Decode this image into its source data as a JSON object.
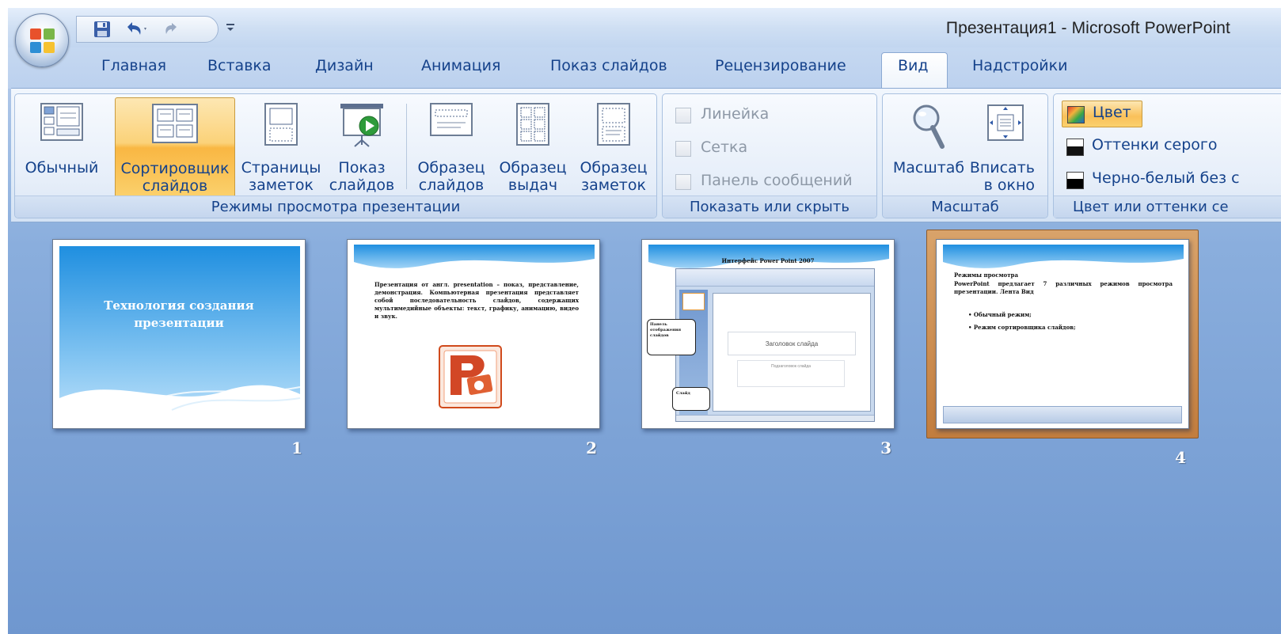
{
  "window": {
    "title": "Презентация1 - Microsoft PowerPoint"
  },
  "tabs": [
    {
      "label": "Главная"
    },
    {
      "label": "Вставка"
    },
    {
      "label": "Дизайн"
    },
    {
      "label": "Анимация"
    },
    {
      "label": "Показ слайдов"
    },
    {
      "label": "Рецензирование"
    },
    {
      "label": "Вид",
      "active": true
    },
    {
      "label": "Надстройки"
    }
  ],
  "ribbon": {
    "views": {
      "label": "Режимы просмотра презентации",
      "buttons": [
        {
          "label": "Обычный",
          "icon": "normal-view-icon"
        },
        {
          "label": "Сортировщик\nслайдов",
          "icon": "slide-sorter-icon",
          "active": true
        },
        {
          "label": "Страницы\nзаметок",
          "icon": "notes-page-icon"
        },
        {
          "label": "Показ\nслайдов",
          "icon": "slide-show-icon"
        },
        {
          "label": "Образец\nслайдов",
          "icon": "slide-master-icon"
        },
        {
          "label": "Образец\nвыдач",
          "icon": "handout-master-icon"
        },
        {
          "label": "Образец\nзаметок",
          "icon": "notes-master-icon"
        }
      ]
    },
    "show_hide": {
      "label": "Показать или скрыть",
      "items": [
        {
          "label": "Линейка"
        },
        {
          "label": "Сетка"
        },
        {
          "label": "Панель сообщений"
        }
      ]
    },
    "zoom": {
      "label": "Масштаб",
      "buttons": [
        {
          "label": "Масштаб",
          "icon": "zoom-icon"
        },
        {
          "label": "Вписать\nв окно",
          "icon": "fit-to-window-icon"
        }
      ]
    },
    "color": {
      "label": "Цвет или оттенки се",
      "items": [
        {
          "label": "Цвет",
          "active": true
        },
        {
          "label": "Оттенки серого"
        },
        {
          "label": "Черно-белый без с"
        }
      ]
    }
  },
  "slides": [
    {
      "number": "1",
      "title": "Технология создания\nпрезентации"
    },
    {
      "number": "2",
      "body": "Презентация от англ. presentation – показ, представление, демонстрация. Компьютерная презентация представляет собой последовательность слайдов, содержащих мультимедийные объекты: текст, графику, анимацию, видео и звук."
    },
    {
      "number": "3",
      "title": "Интерфейс Power Point 2007",
      "callout_left": "Панель отображения слайдов",
      "callout_bottom": "Слайд",
      "inner_title": "Заголовок слайда",
      "inner_subtitle": "Подзаголовок слайда"
    },
    {
      "number": "4",
      "title": "Режимы просмотра",
      "body": "PowerPoint предлагает 7 различных режимов просмотра презентации. Лента Вид",
      "bullets": [
        "Обычный режим;",
        "Режим сортировщика слайдов;"
      ],
      "selected": true
    }
  ],
  "colors": {
    "accent_tab_text": "#15428b",
    "selection_orange": "#f9b743",
    "sorter_bg": "#8aaedd"
  }
}
